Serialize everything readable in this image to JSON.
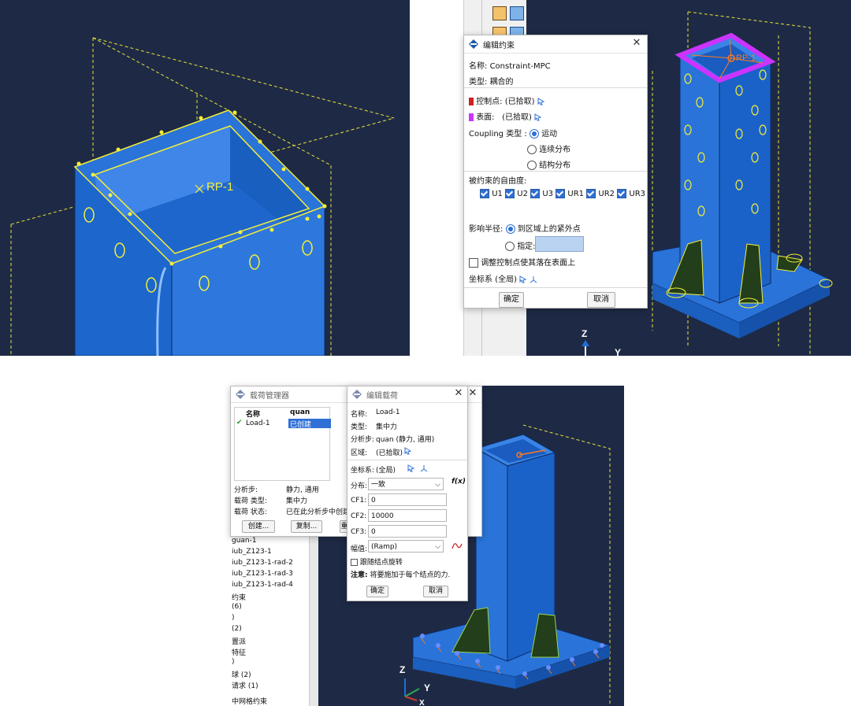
{
  "colors": {
    "viewport_bg": "#1e2a45",
    "model_blue": "#1f6fd6",
    "highlight_yellow": "#f4ef3a",
    "surface_magenta": "#cc33ff",
    "rp_orange": "#ff7a1a"
  },
  "left_view": {
    "rp_label": "RP-1"
  },
  "right_view": {
    "rp_label": "RP-1"
  },
  "constraint_dialog": {
    "title": "编辑约束",
    "name_label": "名称:",
    "name_value": "Constraint-MPC",
    "type_label": "类型:",
    "type_value": "耦合的",
    "control_point_label": "控制点:",
    "control_point_value": "(已拾取)",
    "surface_label": "表面:",
    "surface_value": "(已拾取)",
    "coupling_type_label": "Coupling 类型 :",
    "coupling_options": [
      "运动",
      "连续分布",
      "结构分布"
    ],
    "dof_label": "被约束的自由度:",
    "dof_items": [
      "U1",
      "U2",
      "U3",
      "UR1",
      "UR2",
      "UR3"
    ],
    "influence_label": "影响半径:",
    "influence_options": [
      "到区域上的紧外点",
      "指定:"
    ],
    "adjust_label": "调整控制点使其落在表面上",
    "csys_label": "坐标系 (全局)",
    "ok": "确定",
    "cancel": "取消"
  },
  "axis_top": {
    "z": "Z",
    "y": "Y"
  },
  "load_manager": {
    "title": "载荷管理器",
    "col_name": "名称",
    "col_step": "quan",
    "row_name": "Load-1",
    "row_status": "已创建",
    "step_label": "分析步:",
    "step_value": "静力, 通用",
    "load_type_label": "载荷 类型:",
    "load_type_value": "集中力",
    "load_state_label": "载荷 状态:",
    "load_state_value": "已在此分析步中创建",
    "create_btn": "创建...",
    "copy_btn": "复制...",
    "rename_btn": "重"
  },
  "model_tree": {
    "items": [
      "guan-1",
      "iub_Z123-1",
      "iub_Z123-1-rad-2",
      "iub_Z123-1-rad-3",
      "iub_Z123-1-rad-4",
      "约束",
      "(6)",
      ")",
      "(2)",
      "置派",
      "特征",
      ")",
      "球 (2)",
      "请求 (1)",
      "中网格约束"
    ]
  },
  "load_dialog": {
    "title": "编辑载荷",
    "name_label": "名称:",
    "name_value": "Load-1",
    "type_label": "类型:",
    "type_value": "集中力",
    "step_label": "分析步:",
    "step_value": "quan (静力, 通用)",
    "region_label": "区域:",
    "region_value": "(已拾取)",
    "csys_label": "坐标系:",
    "csys_value": "(全局)",
    "dist_label": "分布:",
    "dist_value": "一致",
    "fx_label": "f(x)",
    "cf1_label": "CF1:",
    "cf1_value": "0",
    "cf2_label": "CF2:",
    "cf2_value": "10000",
    "cf3_label": "CF3:",
    "cf3_value": "0",
    "amp_label": "幅值:",
    "amp_value": "(Ramp)",
    "follow_label": "跟随结点旋转",
    "note_label": "注意:",
    "note_value": "将要施加于每个结点的力.",
    "ok": "确定",
    "cancel": "取消"
  },
  "axis_bottom": {
    "z": "Z",
    "y": "Y",
    "x": "X"
  }
}
